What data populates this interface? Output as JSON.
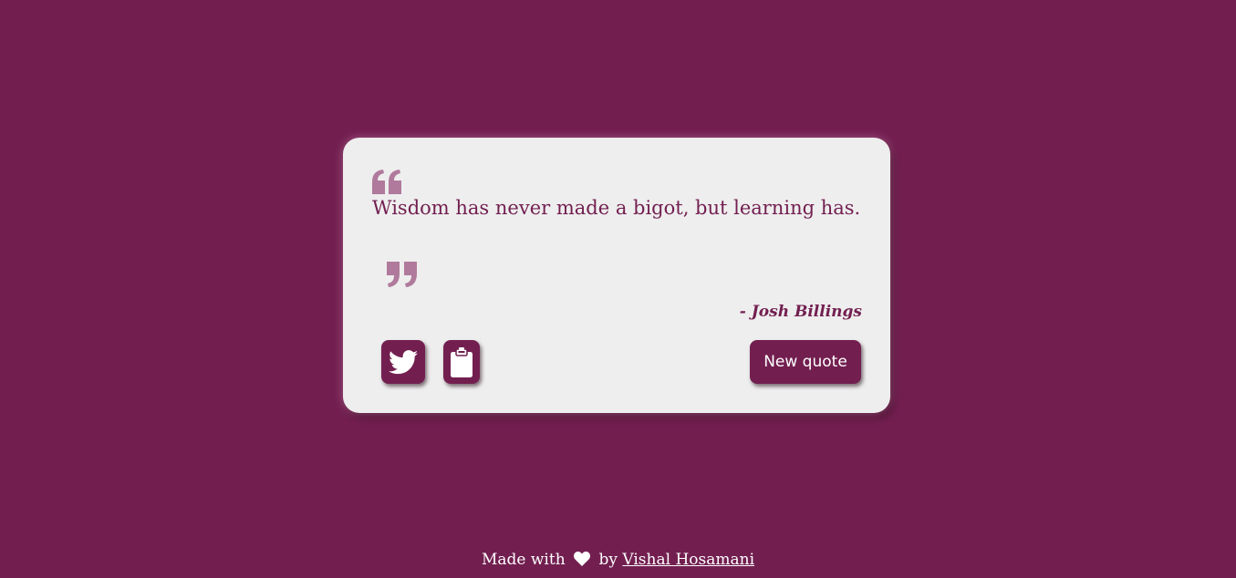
{
  "quote": {
    "text": "Wisdom has never made a bigot, but learning has.",
    "author": "- Josh Billings"
  },
  "buttons": {
    "tweet_icon": "twitter-icon",
    "copy_icon": "clipboard-icon",
    "new_quote_label": "New quote"
  },
  "footer": {
    "made_with": "Made with",
    "heart_icon": "heart-icon",
    "by": "by",
    "author_link": "Vishal Hosamani"
  },
  "colors": {
    "background": "#721f50",
    "card": "#eeeeee",
    "quote_mark": "#b07a9c",
    "accent": "#721f50"
  }
}
